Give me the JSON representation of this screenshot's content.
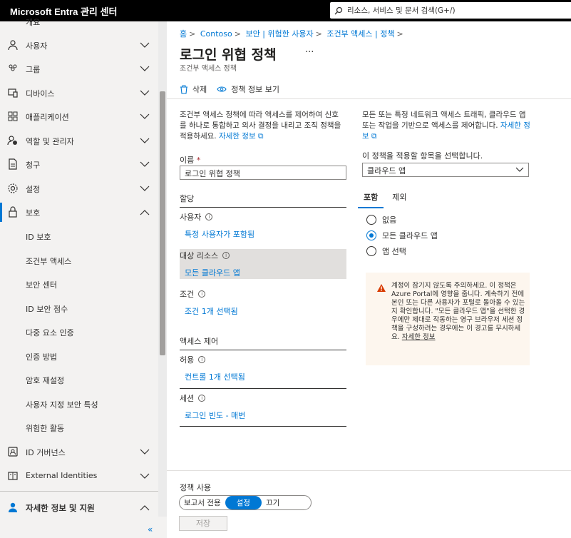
{
  "app": {
    "title": "Microsoft Entra 관리 센터"
  },
  "search": {
    "placeholder": "리소스, 서비스 및 문서 검색(G+/)"
  },
  "sidebar": {
    "items": [
      {
        "label": "개요"
      },
      {
        "label": "사용자"
      },
      {
        "label": "그룹"
      },
      {
        "label": "디바이스"
      },
      {
        "label": "애플리케이션"
      },
      {
        "label": "역할 및 관리자"
      },
      {
        "label": "청구"
      },
      {
        "label": "설정"
      },
      {
        "label": "보호"
      }
    ],
    "sub_items": [
      {
        "label": "ID 보호"
      },
      {
        "label": "조건부 액세스"
      },
      {
        "label": "보안 센터"
      },
      {
        "label": "ID 보안 점수"
      },
      {
        "label": "다중 요소 인증"
      },
      {
        "label": "인증 방법"
      },
      {
        "label": "암호 재설정"
      },
      {
        "label": "사용자 지정 보안 특성"
      },
      {
        "label": "위험한 활동"
      }
    ],
    "bottom_items": [
      {
        "label": "ID 거버넌스"
      },
      {
        "label": "External Identities"
      }
    ],
    "help": {
      "label": "자세한 정보 및 지원"
    },
    "collapse": "«"
  },
  "breadcrumb": [
    "홈",
    "Contoso",
    "보안 | 위험한 사용자",
    "조건부 액세스 | 정책"
  ],
  "page": {
    "title": "로그인 위협 정책",
    "more": "···",
    "subtitle": "조건부 액세스 정책"
  },
  "toolbar": {
    "delete_label": "삭제",
    "view_label": "정책 정보 보기"
  },
  "left": {
    "description": "조건부 액세스 정책에 따라 액세스를 제어하여 신호를 하나로 통합하고 의사 결정을 내리고 조직 정책을 적용하세요.",
    "learn_more": "자세한 정보",
    "name_label": "이름",
    "name_required": "*",
    "name_value": "로그인 위협 정책",
    "assign_header": "할당",
    "users_label": "사용자",
    "users_value": "특정 사용자가 포함됨",
    "resources_label": "대상 리소스",
    "resources_value": "모든 클라우드 앱",
    "conditions_label": "조건",
    "conditions_value": "조건 1개 선택됨",
    "access_header": "액세스 제어",
    "grant_label": "허용",
    "grant_value": "컨트롤 1개 선택됨",
    "session_label": "세션",
    "session_value": "로그인 빈도 - 매번"
  },
  "right": {
    "description": "모든 또는 특정 네트워크 액세스 트래픽, 클라우드 앱 또는 작업을 기반으로 액세스를 제어합니다.",
    "learn_more": "자세한 정보",
    "select_label": "이 정책을 적용할 항목을 선택합니다.",
    "select_value": "클라우드 앱",
    "tabs": [
      {
        "label": "포함"
      },
      {
        "label": "제외"
      }
    ],
    "radios": [
      {
        "label": "없음",
        "checked": false
      },
      {
        "label": "모든 클라우드 앱",
        "checked": true
      },
      {
        "label": "앱 선택",
        "checked": false
      }
    ],
    "warning": {
      "text": "계정이 잠기지 않도록 주의하세요. 이 정책은 Azure Portal에 영향을 줍니다. 계속하기 전에 본인 또는 다른 사용자가 포털로 돌아올 수 있는지 확인합니다. \"모든 클라우드 앱\"을 선택한 경우에만 제대로 작동하는 영구 브라우저 세션 정책을 구성하려는 경우에는 이 경고를 무시하세요.",
      "link": "자세한 정보",
      "color": "#d83b01"
    }
  },
  "footer": {
    "label": "정책 사용",
    "toggle": [
      "보고서 전용",
      "설정",
      "끄기"
    ],
    "selected": "설정",
    "save": "저장"
  },
  "colors": {
    "accent": "#0078d4",
    "topbar": "#000000"
  }
}
